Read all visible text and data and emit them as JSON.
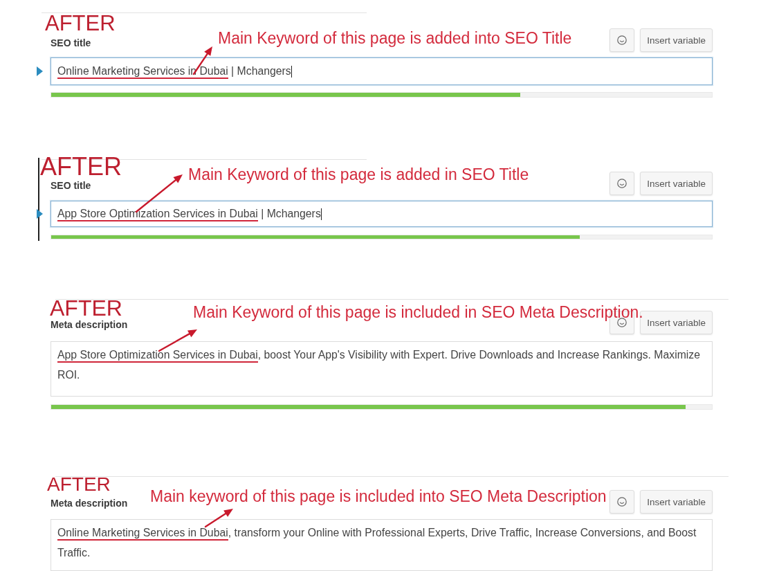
{
  "panels": [
    {
      "kind": "title",
      "heading": "AFTER",
      "label": "SEO title",
      "annotation": "Main Keyword of this page is added into SEO Title",
      "insert_button": "Insert variable",
      "marker": true,
      "focused": true,
      "value": [
        {
          "text": "Online Marketing Services in Dubai",
          "underlined": true
        },
        {
          "text": " | Mchangers",
          "underlined": false
        }
      ],
      "level": 0.71
    },
    {
      "kind": "title",
      "heading": "AFTER",
      "label": "SEO title",
      "annotation": "Main Keyword of this page is added in SEO Title",
      "insert_button": "Insert variable",
      "marker": true,
      "frame_edge": true,
      "focused": true,
      "value": [
        {
          "text": "App Store Optimization Services in Dubai",
          "underlined": true
        },
        {
          "text": " | Mchangers",
          "underlined": false
        }
      ],
      "level": 0.8
    },
    {
      "kind": "description",
      "heading": "AFTER",
      "label": "Meta description",
      "annotation": "Main Keyword of this page is included in SEO Meta Description.",
      "insert_button": "Insert variable",
      "focused": false,
      "value": [
        {
          "text": "App Store Optimization Services in Dubai",
          "underlined": true
        },
        {
          "text": ", boost Your App's Visibility with Expert. Drive Downloads and Increase Rankings. Maximize ROI.",
          "underlined": false
        }
      ],
      "level": 0.96
    },
    {
      "kind": "description",
      "heading": "AFTER",
      "label": "Meta description",
      "annotation": "Main keyword of this page is included into SEO Meta Description",
      "insert_button": "Insert variable",
      "focused": false,
      "value": [
        {
          "text": "Online Marketing Services in Dubai",
          "underlined": true
        },
        {
          "text": ", transform your Online with Professional Experts, Drive Traffic, Increase Conversions, and Boost Traffic.",
          "underlined": false
        }
      ]
    }
  ]
}
